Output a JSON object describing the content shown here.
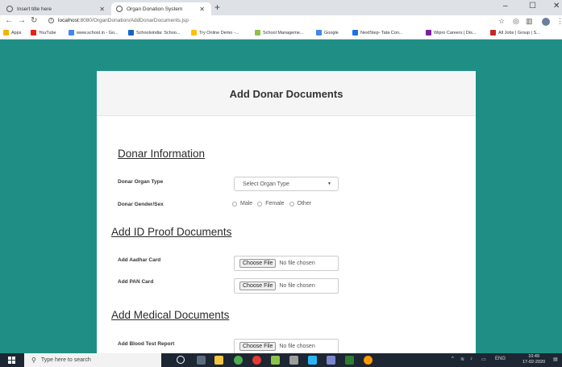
{
  "browser": {
    "tabs": [
      {
        "label": "Insert title here",
        "active": false
      },
      {
        "label": "Organ Donation System",
        "active": true
      }
    ],
    "new_tab_glyph": "+",
    "address": {
      "host": "localhost",
      "path": ":8080/OrganDonation/AddDonarDocuments.jsp"
    },
    "bookmarks": [
      {
        "label": "Apps",
        "icon_color": "#f4b400"
      },
      {
        "label": "YouTube",
        "icon_color": "#e62117"
      },
      {
        "label": "www.school.in - Go...",
        "icon_color": "#4285f4"
      },
      {
        "label": "Schoolsindia: Schoo...",
        "icon_color": "#1565c0"
      },
      {
        "label": "Try Online Demo -...",
        "icon_color": "#ffc107"
      },
      {
        "label": "School Manageme...",
        "icon_color": "#8bc34a"
      },
      {
        "label": "Google",
        "icon_color": "#4285f4"
      },
      {
        "label": "NextStep- Tata Con...",
        "icon_color": "#1a73e8"
      },
      {
        "label": "Wipro Careers | Dis...",
        "icon_color": "#7b1fa2"
      },
      {
        "label": "All Jobs | Group | S...",
        "icon_color": "#c62828"
      }
    ]
  },
  "page": {
    "title": "Add Donar Documents",
    "sections": {
      "donar_info": "Donar Information",
      "id_proof": "Add ID Proof Documents",
      "medical": "Add Medical Documents"
    },
    "fields": {
      "organ_type_label": "Donar Organ Type",
      "organ_type_value": "Select Organ Type",
      "gender_label": "Donar Gender/Sex",
      "gender_options": [
        "Male",
        "Female",
        "Other"
      ],
      "aadhar_label": "Add Aadhar Card",
      "pan_label": "Add PAN Card",
      "blood_label": "Add Blood Test Report"
    },
    "file_input": {
      "button": "Choose File",
      "status": "No file chosen"
    }
  },
  "taskbar": {
    "search_placeholder": "Type here to search",
    "time": "10:49",
    "date": "17-02-2020",
    "lang": "ENG"
  },
  "colors": {
    "page_bg": "#1f8f85",
    "card_bg": "#ffffff",
    "taskbar_bg": "#1d2633"
  }
}
